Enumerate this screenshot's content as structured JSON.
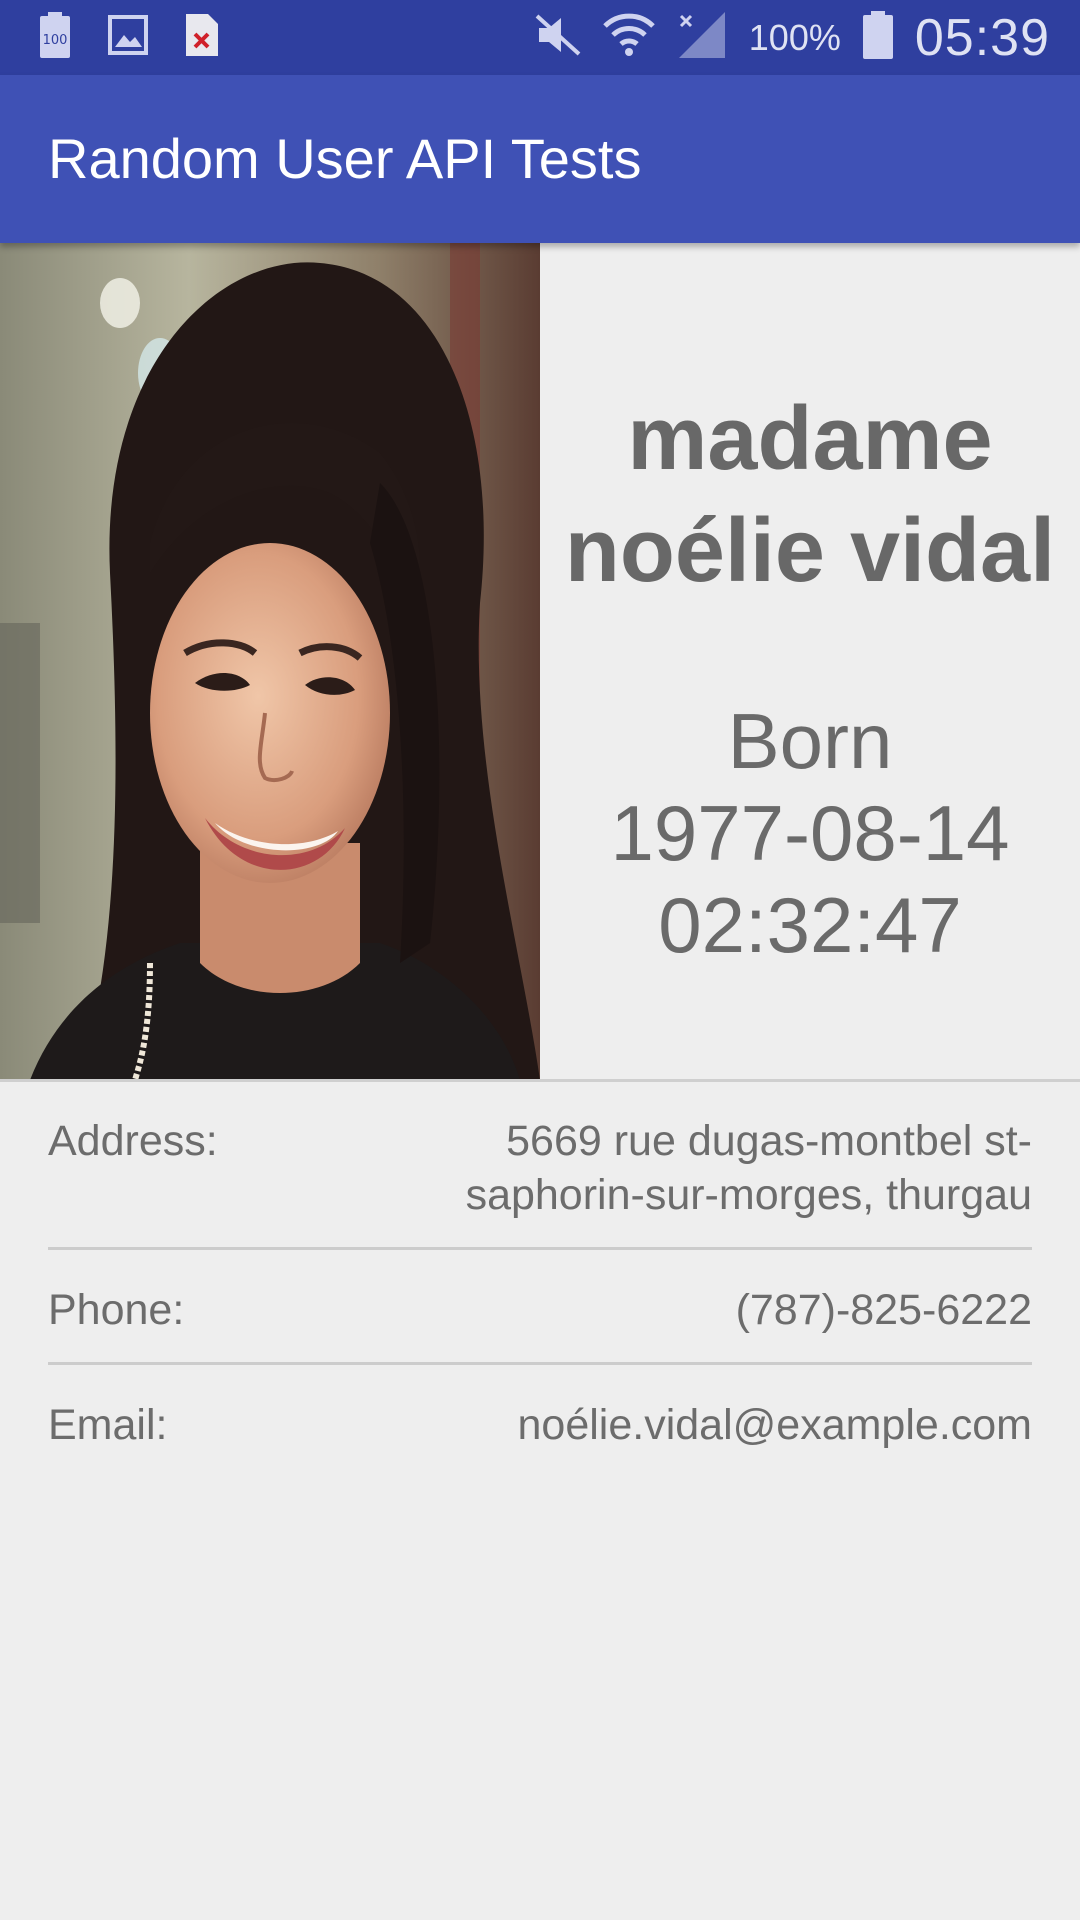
{
  "status_bar": {
    "left_icons": [
      "battery-100-notification-icon",
      "image-notification-icon",
      "error-file-notification-icon"
    ],
    "right_icons": [
      "vibrate-mute-icon",
      "wifi-icon",
      "cell-signal-icon",
      "battery-icon"
    ],
    "battery_percent": "100%",
    "time": "05:39"
  },
  "app_bar": {
    "title": "Random User API Tests"
  },
  "profile": {
    "photo_icon": "profile-photo",
    "name_line1": "madame",
    "name_line2": "noélie vidal",
    "born_label": "Born",
    "born_date": "1977-08-14",
    "born_time": "02:32:47"
  },
  "details": {
    "address_label": "Address:",
    "address_value": "5669 rue dugas-montbel st-saphorin-sur-morges, thurgau",
    "phone_label": "Phone:",
    "phone_value": "(787)-825-6222",
    "email_label": "Email:",
    "email_value": "noélie.vidal@example.com"
  },
  "colors": {
    "status_bar": "#2f3f9f",
    "app_bar": "#3f51b5",
    "background": "#eeeeee",
    "text": "#6c6c6c"
  }
}
